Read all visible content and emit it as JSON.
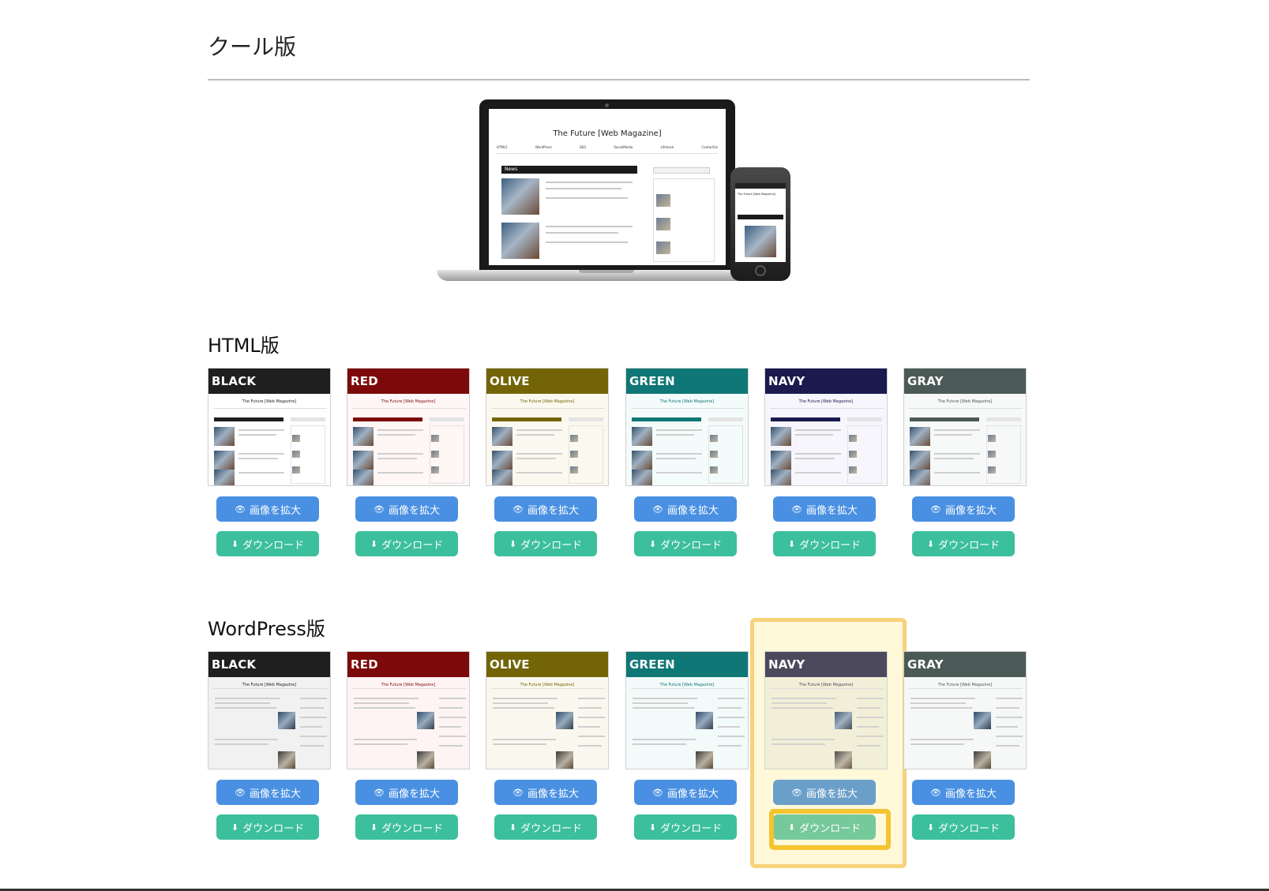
{
  "page": {
    "title": "クール版"
  },
  "hero": {
    "site_title": "The Future [Web Magazine]",
    "nav": [
      "HTML5",
      "WordPress",
      "SEO",
      "SocialMedia",
      "Lifehack",
      "ContactUs"
    ],
    "news_label": "News",
    "phone_news_label": "News"
  },
  "sections": [
    {
      "title": "HTML版",
      "kind": "html",
      "themes": [
        {
          "name": "BLACK",
          "color": "#1f1f1f",
          "tint": "#ffffff"
        },
        {
          "name": "RED",
          "color": "#7d0a0a",
          "tint": "#fff6f6"
        },
        {
          "name": "OLIVE",
          "color": "#736507",
          "tint": "#fbf9ef"
        },
        {
          "name": "GREEN",
          "color": "#0f7775",
          "tint": "#f4fbfb"
        },
        {
          "name": "NAVY",
          "color": "#1a1a4f",
          "tint": "#f6f6fc"
        },
        {
          "name": "GRAY",
          "color": "#4b5a56",
          "tint": "#f7f8f8"
        }
      ]
    },
    {
      "title": "WordPress版",
      "kind": "wp",
      "themes": [
        {
          "name": "BLACK",
          "color": "#1f1f1f",
          "tint": "#f1f1f1"
        },
        {
          "name": "RED",
          "color": "#7d0a0a",
          "tint": "#fff4f4"
        },
        {
          "name": "OLIVE",
          "color": "#736507",
          "tint": "#faf8ee"
        },
        {
          "name": "GREEN",
          "color": "#0f7775",
          "tint": "#f2fafa"
        },
        {
          "name": "NAVY",
          "color": "#3a3650",
          "tint": "#f1eed8"
        },
        {
          "name": "GRAY",
          "color": "#4b5a56",
          "tint": "#f6f7f7"
        }
      ]
    }
  ],
  "buttons": {
    "zoom_label": "画像を拡大",
    "download_label": "ダウンロード"
  },
  "mini_site_title": "The Future [Web Magazine]",
  "colors": {
    "zoom_button": "#4a90e2",
    "download_button": "#3cbf9c",
    "highlight": "#f4c430"
  },
  "icons": {
    "zoom": "eye-icon",
    "download": "download-icon"
  }
}
